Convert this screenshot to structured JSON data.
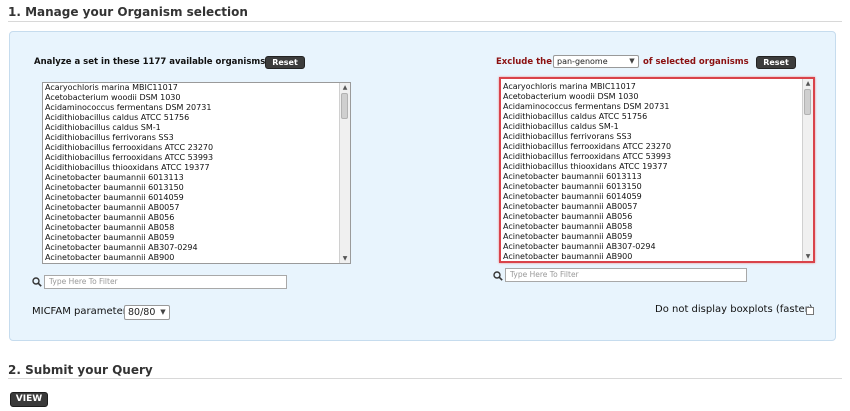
{
  "sections": {
    "manage_title": "1. Manage your Organism selection",
    "submit_title": "2. Submit your Query"
  },
  "left": {
    "label": "Analyze a set in these 1177 available organisms",
    "reset_label": "Reset",
    "filter_placeholder": "Type Here To Filter",
    "organisms": [
      "Acaryochloris marina MBIC11017",
      "Acetobacterium woodii DSM 1030",
      "Acidaminococcus fermentans DSM 20731",
      "Acidithiobacillus caldus ATCC 51756",
      "Acidithiobacillus caldus SM-1",
      "Acidithiobacillus ferrivorans SS3",
      "Acidithiobacillus ferrooxidans ATCC 23270",
      "Acidithiobacillus ferrooxidans ATCC 53993",
      "Acidithiobacillus thiooxidans ATCC 19377",
      "Acinetobacter baumannii 6013113",
      "Acinetobacter baumannii 6013150",
      "Acinetobacter baumannii 6014059",
      "Acinetobacter baumannii AB0057",
      "Acinetobacter baumannii AB056",
      "Acinetobacter baumannii AB058",
      "Acinetobacter baumannii AB059",
      "Acinetobacter baumannii AB307-0294",
      "Acinetobacter baumannii AB900"
    ]
  },
  "right": {
    "label_prefix": "Exclude the",
    "genome_select": "pan-genome",
    "label_suffix": "of selected organisms",
    "reset_label": "Reset",
    "filter_placeholder": "Type Here To Filter",
    "organisms": [
      "Acaryochloris marina MBIC11017",
      "Acetobacterium woodii DSM 1030",
      "Acidaminococcus fermentans DSM 20731",
      "Acidithiobacillus caldus ATCC 51756",
      "Acidithiobacillus caldus SM-1",
      "Acidithiobacillus ferrivorans SS3",
      "Acidithiobacillus ferrooxidans ATCC 23270",
      "Acidithiobacillus ferrooxidans ATCC 53993",
      "Acidithiobacillus thiooxidans ATCC 19377",
      "Acinetobacter baumannii 6013113",
      "Acinetobacter baumannii 6013150",
      "Acinetobacter baumannii 6014059",
      "Acinetobacter baumannii AB0057",
      "Acinetobacter baumannii AB056",
      "Acinetobacter baumannii AB058",
      "Acinetobacter baumannii AB059",
      "Acinetobacter baumannii AB307-0294",
      "Acinetobacter baumannii AB900"
    ]
  },
  "micfam": {
    "label": "MICFAM parameter:",
    "value": "80/80"
  },
  "boxplots_label": "Do not display boxplots (faster)",
  "view_label": "VIEW"
}
